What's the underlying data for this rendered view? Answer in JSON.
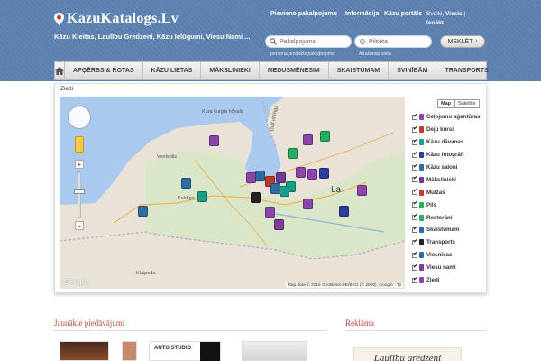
{
  "header": {
    "site_name": "KāzuKatalogs.Lv",
    "tagline": "Kāzu Kleitas, Laulību Gredzeni, Kāzu Ielūgumi, Viesu Nami ...",
    "links": [
      "Pievieno pakalpojumu",
      "Informācija",
      "Kāzu portāls"
    ],
    "lang_current": "Sveiki",
    "lang_other": "Viesis",
    "lang_login": "Ienākt"
  },
  "search": {
    "service_placeholder": "Pakalpojums",
    "city_placeholder": "Pilsēta",
    "service_hint": "persona,produkts,pakalpojums",
    "city_hint": "Atrašanās vieta",
    "button_label": "MEKLĒT"
  },
  "nav": {
    "items": [
      "APĢĒRBS & ROTAS",
      "KĀZU LIETAS",
      "MĀKSLINIEKI",
      "MEDUSMĒNESIM",
      "SKAISTUMAM",
      "SVINĪBĀM",
      "TRANSPORTS"
    ]
  },
  "map": {
    "title": "Ziedi",
    "type_map": "Map",
    "type_satellite": "Satellite",
    "labels": [
      "Kura kurgla hõvala",
      "Gulf of Riga",
      "Ventspils",
      "Kuldīga",
      "Klaipeda",
      "La"
    ],
    "attribution": "Map data © 2015 GeoBasis-DE/BKG (© 2009), Google · Te",
    "google": "Google"
  },
  "legend": {
    "items": [
      {
        "label": "Ceļojumu aģentūras",
        "color": "#8e44ad"
      },
      {
        "label": "Deju kursi",
        "color": "#c0392b"
      },
      {
        "label": "Kāzu dāvanas",
        "color": "#16a085"
      },
      {
        "label": "Kāzu fotogrāfi",
        "color": "#2c3e99"
      },
      {
        "label": "Kāzu saloni",
        "color": "#2e6da4"
      },
      {
        "label": "Mākslinieki",
        "color": "#6a3d9a"
      },
      {
        "label": "Mulžas",
        "color": "#c0392b"
      },
      {
        "label": "Pils",
        "color": "#27ae60"
      },
      {
        "label": "Restorāni",
        "color": "#27ae60"
      },
      {
        "label": "Skaistumam",
        "color": "#2e6da4"
      },
      {
        "label": "Transports",
        "color": "#222222"
      },
      {
        "label": "Viesnīcas",
        "color": "#2e6da4"
      },
      {
        "label": "Viesu nami",
        "color": "#7d3c98"
      },
      {
        "label": "Ziedi",
        "color": "#8e44ad"
      }
    ]
  },
  "bottom": {
    "latest_title": "Jaunākie piedāvājumi",
    "ads_title": "Reklāma",
    "thumb_studio": "ANTO STUDIO",
    "ad_text": "Laulību gredzeni"
  }
}
